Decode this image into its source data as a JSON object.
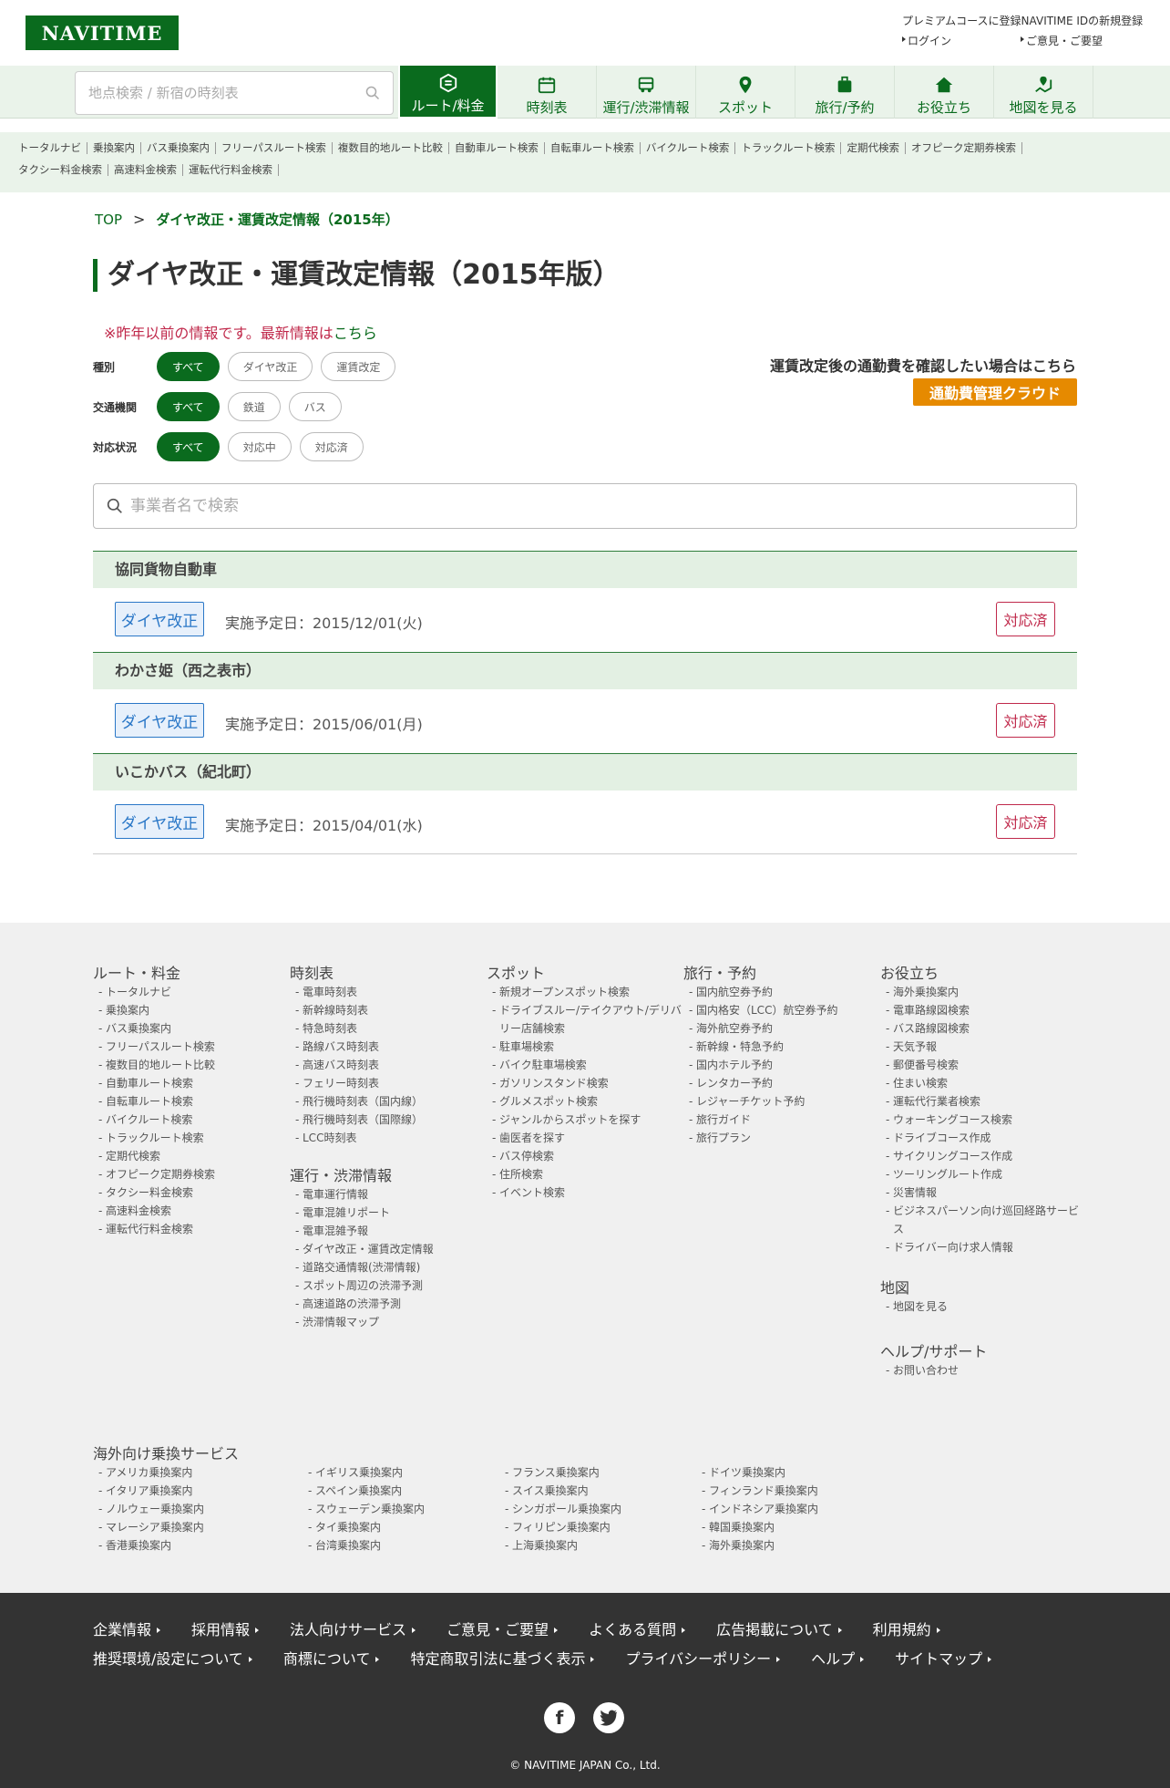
{
  "header": {
    "logo": "NAVITIME",
    "premium_link": "プレミアムコースに登録NAVITIME IDの新規登録",
    "login": "ログイン",
    "feedback": "ご意見・ご要望",
    "search_placeholder": "地点検索 / 新宿の時刻表"
  },
  "nav": {
    "items": [
      {
        "label": "ルート/料金",
        "icon": "route-icon"
      },
      {
        "label": "時刻表",
        "icon": "timetable-icon"
      },
      {
        "label": "運行/渋滞情報",
        "icon": "traffic-icon"
      },
      {
        "label": "スポット",
        "icon": "pin-icon"
      },
      {
        "label": "旅行/予約",
        "icon": "luggage-icon"
      },
      {
        "label": "お役立ち",
        "icon": "house-icon"
      },
      {
        "label": "地図を見る",
        "icon": "map-icon"
      }
    ]
  },
  "subnav": {
    "line1": [
      "トータルナビ",
      "乗換案内",
      "バス乗換案内",
      "フリーパスルート検索",
      "複数目的地ルート比較",
      "自動車ルート検索",
      "自転車ルート検索",
      "バイクルート検索",
      "トラックルート検索",
      "定期代検索",
      "オフピーク定期券検索"
    ],
    "line2": [
      "タクシー料金検索",
      "高速料金検索",
      "運転代行料金検索"
    ]
  },
  "breadcrumb": {
    "top": "TOP",
    "sep": ">",
    "current": "ダイヤ改正・運賃改定情報（2015年）"
  },
  "page_title": "ダイヤ改正・運賃改定情報（2015年版）",
  "notice": {
    "text": "※昨年以前の情報です。最新情報は",
    "link": "こちら"
  },
  "filters": {
    "type": {
      "label": "種別",
      "options": [
        "すべて",
        "ダイヤ改正",
        "運賃改定"
      ]
    },
    "transport": {
      "label": "交通機関",
      "options": [
        "すべて",
        "鉄道",
        "バス"
      ]
    },
    "status": {
      "label": "対応状況",
      "options": [
        "すべて",
        "対応中",
        "対応済"
      ]
    }
  },
  "commute": {
    "text": "運賃改定後の通勤費を確認したい場合はこちら",
    "button": "通勤費管理クラウド"
  },
  "company_search_placeholder": "事業者名で検索",
  "companies": [
    {
      "name": "協同貨物自動車",
      "tag": "ダイヤ改正",
      "date": "実施予定日：2015/12/01(火)",
      "status": "対応済"
    },
    {
      "name": "わかさ姫（西之表市）",
      "tag": "ダイヤ改正",
      "date": "実施予定日：2015/06/01(月)",
      "status": "対応済"
    },
    {
      "name": "いこかバス（紀北町）",
      "tag": "ダイヤ改正",
      "date": "実施予定日：2015/04/01(水)",
      "status": "対応済"
    }
  ],
  "footer": {
    "route": {
      "title": "ルート・料金",
      "items": [
        "トータルナビ",
        "乗換案内",
        "バス乗換案内",
        "フリーパスルート検索",
        "複数目的地ルート比較",
        "自動車ルート検索",
        "自転車ルート検索",
        "バイクルート検索",
        "トラックルート検索",
        "定期代検索",
        "オフピーク定期券検索",
        "タクシー料金検索",
        "高速料金検索",
        "運転代行料金検索"
      ]
    },
    "timetable": {
      "title": "時刻表",
      "items": [
        "電車時刻表",
        "新幹線時刻表",
        "特急時刻表",
        "路線バス時刻表",
        "高速バス時刻表",
        "フェリー時刻表",
        "飛行機時刻表（国内線）",
        "飛行機時刻表（国際線）",
        "LCC時刻表"
      ]
    },
    "operation": {
      "title": "運行・渋滞情報",
      "items": [
        "電車運行情報",
        "電車混雑リポート",
        "電車混雑予報",
        "ダイヤ改正・運賃改定情報",
        "道路交通情報(渋滞情報)",
        "スポット周辺の渋滞予測",
        "高速道路の渋滞予測",
        "渋滞情報マップ"
      ]
    },
    "spot": {
      "title": "スポット",
      "items": [
        "新規オープンスポット検索",
        "ドライブスルー/テイクアウト/デリバリー店舗検索",
        "駐車場検索",
        "バイク駐車場検索",
        "ガソリンスタンド検索",
        "グルメスポット検索",
        "ジャンルからスポットを探す",
        "歯医者を探す",
        "バス停検索",
        "住所検索",
        "イベント検索"
      ]
    },
    "travel": {
      "title": "旅行・予約",
      "items": [
        "国内航空券予約",
        "国内格安（LCC）航空券予約",
        "海外航空券予約",
        "新幹線・特急予約",
        "国内ホテル予約",
        "レンタカー予約",
        "レジャーチケット予約",
        "旅行ガイド",
        "旅行プラン"
      ]
    },
    "useful": {
      "title": "お役立ち",
      "items": [
        "海外乗換案内",
        "電車路線図検索",
        "バス路線図検索",
        "天気予報",
        "郵便番号検索",
        "住まい検索",
        "運転代行業者検索",
        "ウォーキングコース検索",
        "ドライブコース作成",
        "サイクリングコース作成",
        "ツーリングルート作成",
        "災害情報",
        "ビジネスパーソン向け巡回経路サービス",
        "ドライバー向け求人情報"
      ]
    },
    "map": {
      "title": "地図",
      "items": [
        "地図を見る"
      ]
    },
    "help": {
      "title": "ヘルプ/サポート",
      "items": [
        "お問い合わせ"
      ]
    },
    "overseas": {
      "title": "海外向け乗換サービス",
      "col1": [
        "アメリカ乗換案内",
        "イタリア乗換案内",
        "ノルウェー乗換案内",
        "マレーシア乗換案内",
        "香港乗換案内"
      ],
      "col2": [
        "イギリス乗換案内",
        "スペイン乗換案内",
        "スウェーデン乗換案内",
        "タイ乗換案内",
        "台湾乗換案内"
      ],
      "col3": [
        "フランス乗換案内",
        "スイス乗換案内",
        "シンガポール乗換案内",
        "フィリピン乗換案内",
        "上海乗換案内"
      ],
      "col4": [
        "ドイツ乗換案内",
        "フィンランド乗換案内",
        "インドネシア乗換案内",
        "韓国乗換案内",
        "海外乗換案内"
      ]
    }
  },
  "dark_footer": {
    "links": [
      "企業情報",
      "採用情報",
      "法人向けサービス",
      "ご意見・ご要望",
      "よくある質問",
      "広告掲載について",
      "利用規約",
      "推奨環境/設定について",
      "商標について",
      "特定商取引法に基づく表示",
      "プライバシーポリシー",
      "ヘルプ",
      "サイトマップ"
    ],
    "social": [
      "facebook-icon",
      "twitter-icon"
    ],
    "copyright": "© NAVITIME JAPAN Co., Ltd."
  }
}
